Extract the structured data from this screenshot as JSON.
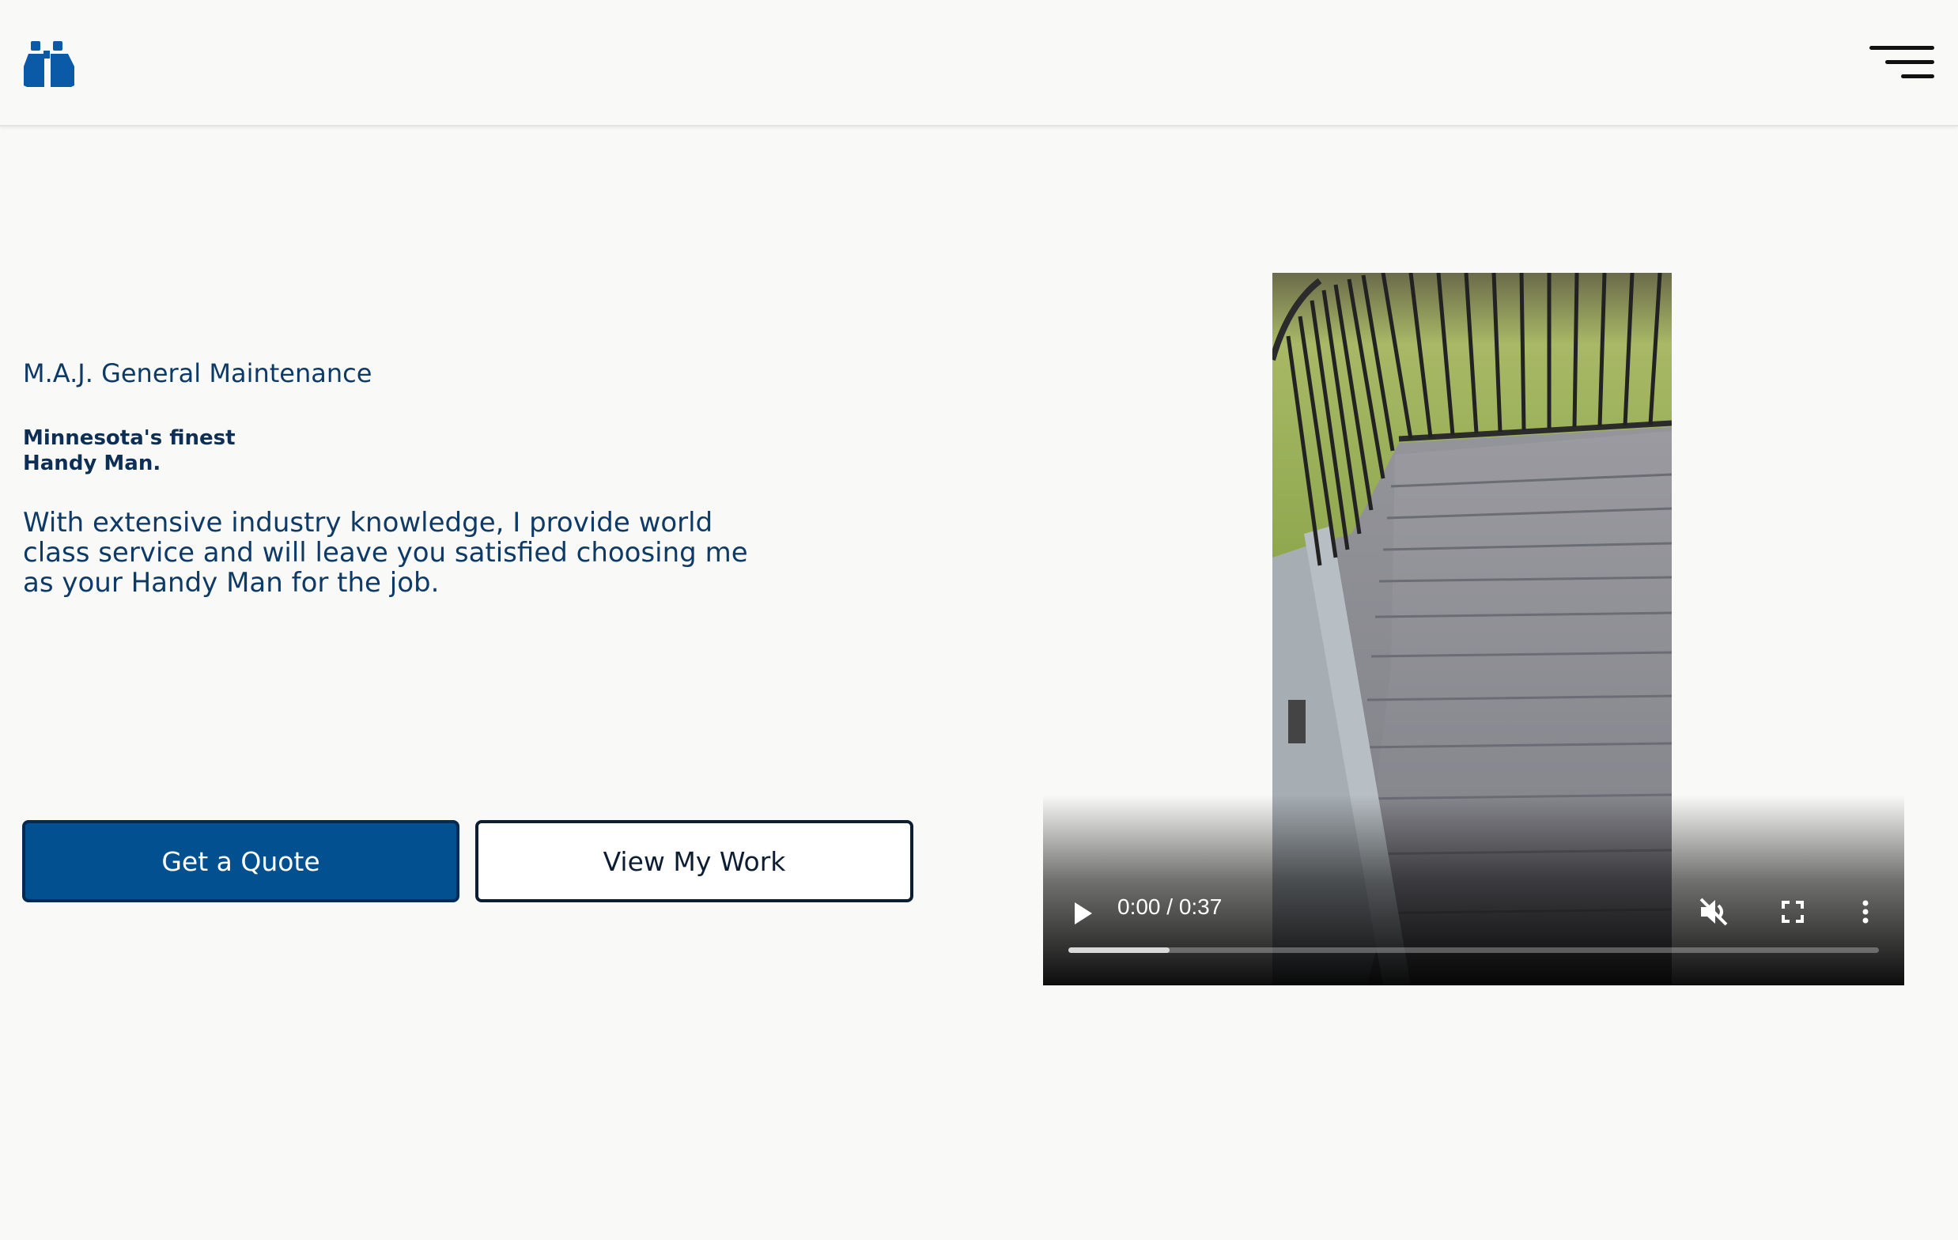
{
  "header": {
    "logo_icon": "binoculars-icon",
    "menu_icon": "hamburger-menu-icon"
  },
  "hero": {
    "company": "M.A.J. General Maintenance",
    "tagline_line1": "Minnesota's finest",
    "tagline_line2": "Handy Man.",
    "description": "With extensive industry knowledge, I provide world class service and will leave you satisfied choosing me as your Handy Man for the job."
  },
  "buttons": {
    "quote_label": "Get a Quote",
    "work_label": "View My Work"
  },
  "video": {
    "time": "0:00 / 0:37",
    "progress_fraction": 0.125,
    "play_icon": "play-icon",
    "mute_icon": "muted-speaker-icon",
    "fullscreen_icon": "fullscreen-icon",
    "more_icon": "more-vertical-icon"
  },
  "colors": {
    "brand_blue": "#02508f",
    "text_navy": "#0d3a66",
    "background": "#f9f9f7"
  }
}
